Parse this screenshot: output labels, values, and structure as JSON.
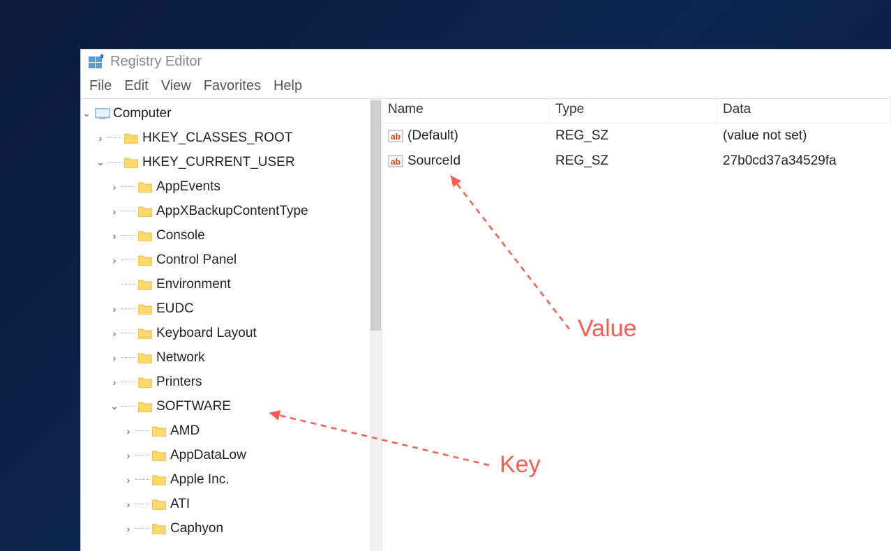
{
  "title": "Registry Editor",
  "menu": {
    "file": "File",
    "edit": "Edit",
    "view": "View",
    "favorites": "Favorites",
    "help": "Help"
  },
  "tree": {
    "root": "Computer",
    "hkcr": "HKEY_CLASSES_ROOT",
    "hkcu": "HKEY_CURRENT_USER",
    "nodes": {
      "appevents": "AppEvents",
      "appxbackup": "AppXBackupContentType",
      "console": "Console",
      "controlpanel": "Control Panel",
      "environment": "Environment",
      "eudc": "EUDC",
      "keyboard": "Keyboard Layout",
      "network": "Network",
      "printers": "Printers",
      "software": "SOFTWARE",
      "amd": "AMD",
      "appdatalow": "AppDataLow",
      "apple": "Apple Inc.",
      "ati": "ATI",
      "caphyon": "Caphyon"
    }
  },
  "columns": {
    "name": "Name",
    "type": "Type",
    "data": "Data"
  },
  "values": [
    {
      "name": "(Default)",
      "type": "REG_SZ",
      "data": "(value not set)"
    },
    {
      "name": "SourceId",
      "type": "REG_SZ",
      "data": "27b0cd37a34529fa"
    }
  ],
  "annotations": {
    "value": "Value",
    "key": "Key"
  }
}
